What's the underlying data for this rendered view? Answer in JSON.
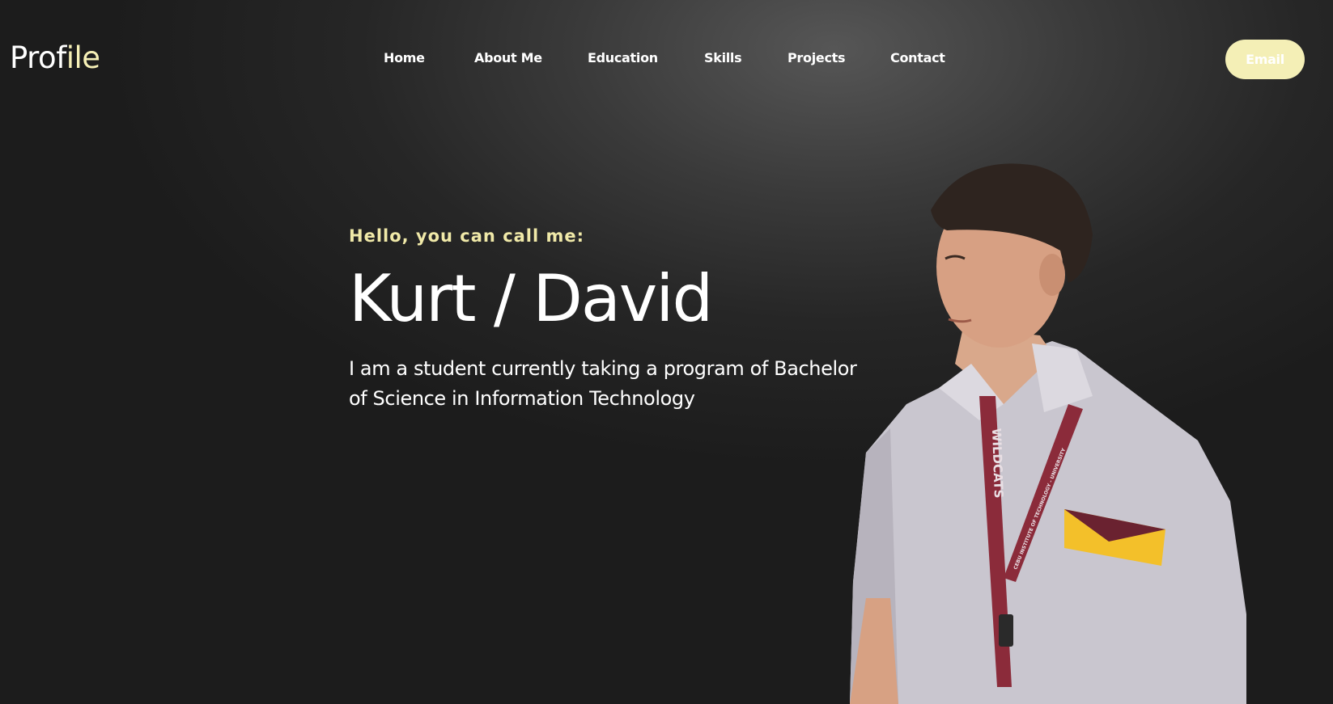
{
  "header": {
    "logo_main": "Prof",
    "logo_accent": "ile",
    "nav": [
      {
        "label": "Home"
      },
      {
        "label": "About Me"
      },
      {
        "label": "Education"
      },
      {
        "label": "Skills"
      },
      {
        "label": "Projects"
      },
      {
        "label": "Contact"
      }
    ],
    "email_label": "Email"
  },
  "hero": {
    "greeting": "Hello, you can call me:",
    "name": "Kurt / David",
    "tagline": "I am a student currently taking a program of Bachelor of Science in Information Technology"
  },
  "photo": {
    "lanyard_left": "WILDCATS",
    "lanyard_right": "CEBU INSTITUTE OF TECHNOLOGY - UNIVERSITY"
  },
  "colors": {
    "accent": "#f6f0b6",
    "button_bg": "#f4efb6",
    "background": "#262626",
    "lanyard": "#8b2b3a",
    "shirt": "#c9c6cf",
    "pocket_stripe": "#f3c02a"
  }
}
